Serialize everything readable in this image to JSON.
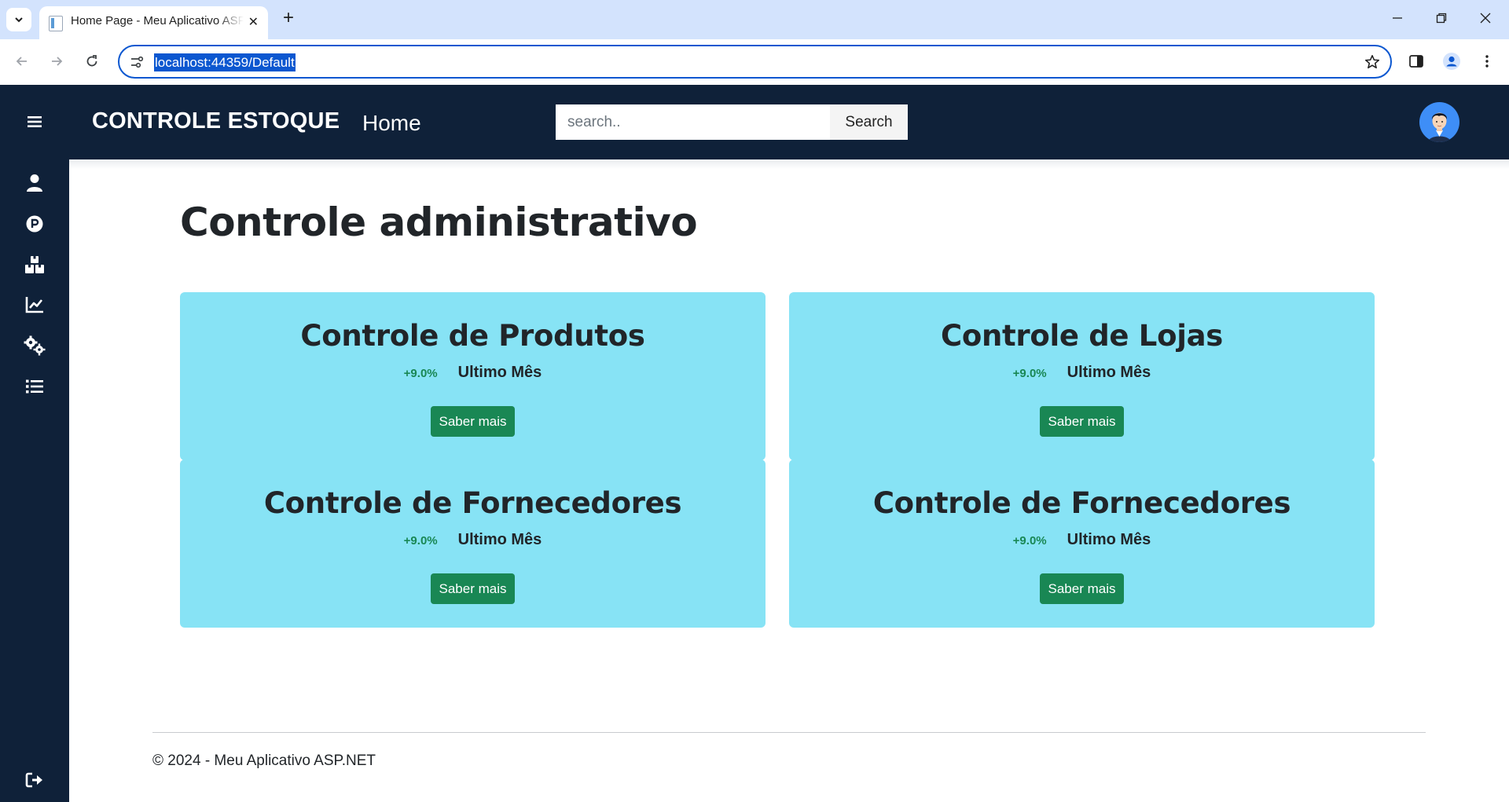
{
  "browser": {
    "tab_title": "Home Page - Meu Aplicativo ASP.NET",
    "tab_close": "✕",
    "new_tab": "+",
    "url": "localhost:44359/Default"
  },
  "app": {
    "brand": "CONTROLE ESTOQUE",
    "page_name": "Home",
    "search": {
      "placeholder": "search..",
      "button_label": "Search"
    },
    "sidebar": {
      "items": [
        {
          "icon": "user-icon"
        },
        {
          "icon": "parking-icon"
        },
        {
          "icon": "boxes-icon"
        },
        {
          "icon": "chart-line-icon"
        },
        {
          "icon": "gears-icon"
        },
        {
          "icon": "list-icon"
        }
      ],
      "logout_icon": "sign-out-icon"
    }
  },
  "main": {
    "title": "Controle administrativo",
    "cards": [
      {
        "title": "Controle de Produtos",
        "change": "+9.0%",
        "period": "Ultimo Mês",
        "button": "Saber mais"
      },
      {
        "title": "Controle de Lojas",
        "change": "+9.0%",
        "period": "Ultimo Mês",
        "button": "Saber mais"
      },
      {
        "title": "Controle de Fornecedores",
        "change": "+9.0%",
        "period": "Ultimo Mês",
        "button": "Saber mais"
      },
      {
        "title": "Controle de Fornecedores",
        "change": "+9.0%",
        "period": "Ultimo Mês",
        "button": "Saber mais"
      }
    ]
  },
  "footer": {
    "text": "© 2024 - Meu Aplicativo ASP.NET"
  },
  "colors": {
    "sidebar_bg": "#0f2139",
    "card_bg": "#87e3f5",
    "button_green": "#198754",
    "accent_blue": "#0b57d0"
  }
}
